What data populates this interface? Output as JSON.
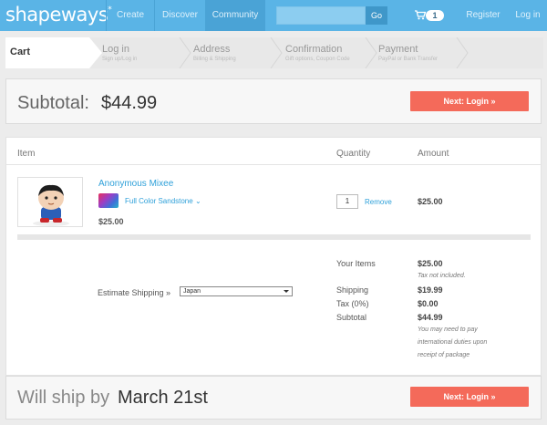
{
  "nav": {
    "logo": "shapeways",
    "logo_mark": "*",
    "create": "Create",
    "discover": "Discover",
    "community": "Community",
    "search_placeholder": "",
    "search_button": "Go",
    "cart_count": "1",
    "register": "Register",
    "login": "Log in",
    "colors": {
      "bar": "#5ab4e6",
      "active": "#4aa3d6"
    }
  },
  "steps": [
    {
      "title": "Cart",
      "sub": ""
    },
    {
      "title": "Log in",
      "sub": "Sign up/Log in"
    },
    {
      "title": "Address",
      "sub": "Billing & Shipping"
    },
    {
      "title": "Confirmation",
      "sub": "Gift options, Coupon Code"
    },
    {
      "title": "Payment",
      "sub": "PayPal or Bank Transfer"
    }
  ],
  "subtotal": {
    "label": "Subtotal:",
    "value": "$44.99",
    "next_button": "Next: Login »"
  },
  "cart": {
    "headers": {
      "item": "Item",
      "quantity": "Quantity",
      "amount": "Amount"
    },
    "items": [
      {
        "name": "Anonymous Mixee",
        "material": "Full Color Sandstone",
        "price": "$25.00",
        "quantity": "1",
        "remove": "Remove",
        "amount": "$25.00"
      }
    ],
    "shipping_estimate": {
      "label": "Estimate Shipping »",
      "country": "Japan"
    },
    "summary": {
      "your_items_label": "Your Items",
      "your_items_value": "$25.00",
      "tax_note": "Tax not included.",
      "shipping_label": "Shipping",
      "shipping_value": "$19.99",
      "tax_label": "Tax (0%)",
      "tax_value": "$0.00",
      "subtotal_label": "Subtotal",
      "subtotal_value": "$44.99",
      "duties_note": [
        "You may need to pay",
        "international duties upon",
        "receipt of package"
      ]
    }
  },
  "ship": {
    "label": "Will ship by",
    "date": "March 21st",
    "next_button": "Next: Login »"
  },
  "accent": "#f46a5a",
  "link_color": "#2ea0d9"
}
